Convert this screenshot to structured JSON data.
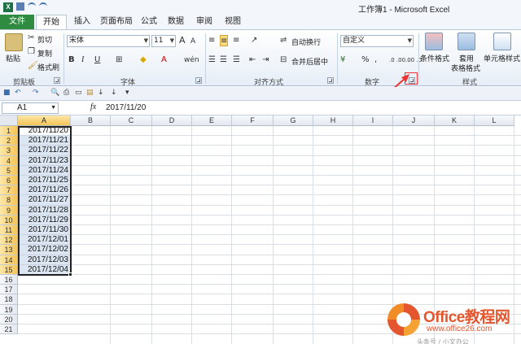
{
  "window": {
    "title": "工作簿1 - Microsoft Excel"
  },
  "tabs": [
    "文件",
    "开始",
    "插入",
    "页面布局",
    "公式",
    "数据",
    "审阅",
    "视图"
  ],
  "ribbon": {
    "clipboard": {
      "paste": "粘贴",
      "cut": "剪切",
      "copy": "复制",
      "format_painter": "格式刷",
      "label": "剪贴板"
    },
    "font": {
      "name": "宋体",
      "size": "11",
      "grow": "A",
      "shrink": "A",
      "bold": "B",
      "italic": "I",
      "underline": "U",
      "wen": "wén",
      "label": "字体"
    },
    "alignment": {
      "wrap": "自动换行",
      "merge": "合并后居中",
      "label": "对齐方式"
    },
    "number": {
      "format": "自定义",
      "percent": "%",
      "comma": ",",
      "inc_dec": ".0 .00",
      "dec_dec": ".00 .0",
      "label": "数字"
    },
    "styles": {
      "conditional": "条件格式",
      "table_format_1": "套用",
      "table_format_2": "表格格式",
      "cell_styles": "单元格样式",
      "label": "样式"
    }
  },
  "formula_bar": {
    "name_box": "A1",
    "fx": "fx",
    "content": "2017/11/20"
  },
  "grid": {
    "columns": [
      "A",
      "B",
      "C",
      "D",
      "E",
      "F",
      "G",
      "H",
      "I",
      "J",
      "K",
      "L"
    ],
    "rows": [
      "1",
      "2",
      "3",
      "4",
      "5",
      "6",
      "7",
      "8",
      "9",
      "10",
      "11",
      "12",
      "13",
      "14",
      "15",
      "16",
      "17",
      "18",
      "19",
      "20",
      "21"
    ],
    "cells_A": [
      "2017/11/20",
      "2017/11/21",
      "2017/11/22",
      "2017/11/23",
      "2017/11/24",
      "2017/11/25",
      "2017/11/26",
      "2017/11/27",
      "2017/11/28",
      "2017/11/29",
      "2017/11/30",
      "2017/12/01",
      "2017/12/02",
      "2017/12/03",
      "2017/12/04"
    ]
  },
  "watermark": {
    "brand": "Office教程网",
    "url": "www.office26.com",
    "caption": "头条号 / 小文办公"
  },
  "colors": {
    "file_tab": "#2e8b3f",
    "selection_header": "#f5c557",
    "annotation": "#ee3333"
  }
}
